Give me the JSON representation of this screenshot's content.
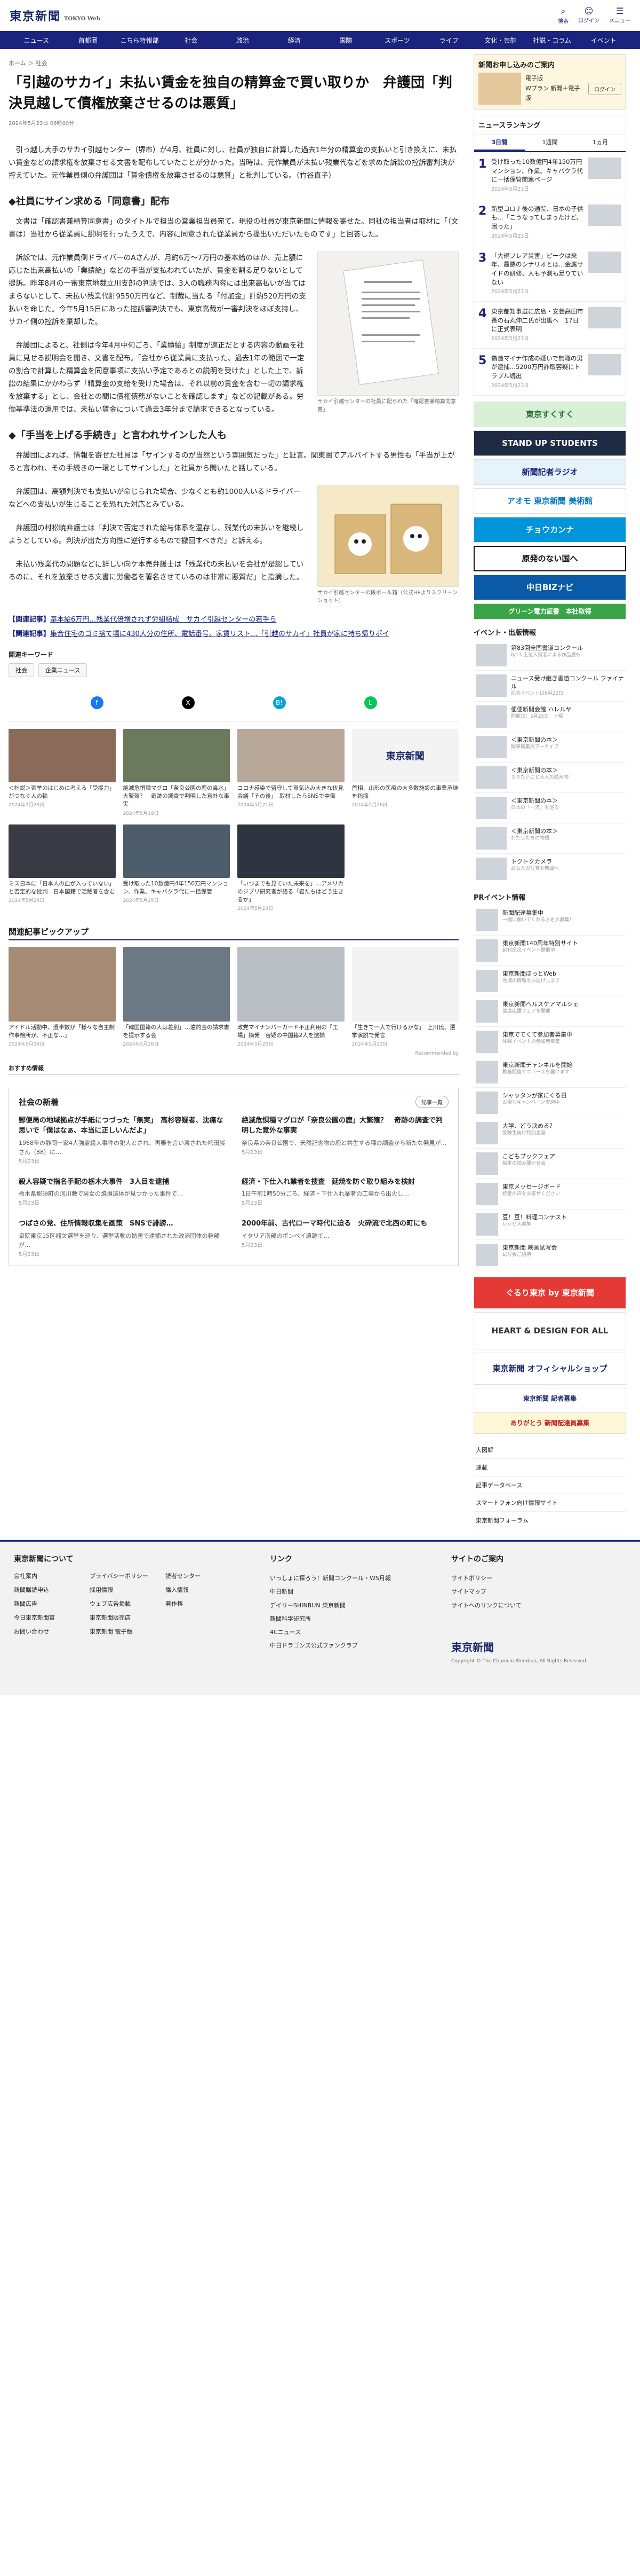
{
  "header": {
    "logo": "東京新聞",
    "logo_sub": "TOKYO Web",
    "icons": [
      {
        "name": "検索"
      },
      {
        "name": "ログイン"
      },
      {
        "name": "メニュー"
      }
    ]
  },
  "nav": [
    "ニュース",
    "首都圏",
    "こちら特報部",
    "社会",
    "政治",
    "経済",
    "国際",
    "スポーツ",
    "ライフ",
    "文化・芸能",
    "社説・コラム",
    "イベント"
  ],
  "breadcrumb": "ホーム ＞ 社会",
  "article": {
    "title": "「引越のサカイ」未払い賃金を独自の精算金で買い取りか　弁護団「判決見越して債権放棄させるのは悪質」",
    "date": "2024年5月23日 06時00分",
    "p1": "引っ越し大手のサカイ引越センター（堺市）が4月、社員に対し、社員が独自に計算した過去1年分の精算金の支払いと引き換えに、未払い賃金などの請求権を放棄させる文書を配布していたことが分かった。当時は、元作業員が未払い残業代などを求めた訴訟の控訴審判決が控えていた。元作業員側の弁護団は「賃金債権を放棄させるのは悪質」と批判している。（竹谷直子）",
    "h_a": "◆社員にサイン求める「同意書」配布",
    "p2": "文書は「確認書兼精算同意書」のタイトルで担当の営業担当員宛て。現役の社員が東京新聞に情報を寄せた。同社の担当者は取材に「（文書は）当社から従業員に説明を行ったうえで、内容に同意された従業員から提出いただいたものです」と回答した。",
    "p3": "訴訟では、元作業員側ドライバーのAさんが、月約6万～7万円の基本給のほか、売上額に応じた出来高払いの「業績給」などの手当が支払われていたが、賃金を割る足りないとして提訴。昨年8月の一審東京地裁立川支部の判決では、3人の職務内容には出来高払いが当てはまらないとして、未払い残業代計9550万円など、制裁に当たる「付加金」計約520万円の支払いを命じた。今年5月15日にあった控訴審判決でも、東京高裁が一審判決をほぼ支持し、サカイ側の控訴を棄却した。",
    "p4": "弁護団によると、社側は今年4月中旬ごろ、「業績給」制度が適正だとする内容の動画を社員に見せる説明会を開き、文書を配布。「会社から従業員に支払った、過去1年の範囲で一定の割合で計算した精算金を同意事項に支払い予定であるとの説明を受けた」とした上で、訴訟の結果にかかわらず「精算金の支給を受けた場合は、それ以前の賃金を含む一切の請求権を放棄する」とし、会社との間に債権債務がないことを確認します」などの記載がある。労働基準法の運用では、未払い賃金について過去3年分まで請求できるとなっている。",
    "fig1_cap": "サカイ引越センターの社員に配られた「確認書兼精算同意書」",
    "h_b": "◆「手当を上げる手続き」と言われサインした人も",
    "p5": "弁護団によれば、情報を寄せた社員は「サインするのが当然という雰囲気だった」と証言。関東圏でアルバイトする男性も「手当が上がると言われ、その手続きの一環としてサインした」と社員から聞いたと話している。",
    "p6": "弁護団は、高額判決でも支払いが命じられた場合、少なくとも約1000人いるドライバーなどへの支払いが生じることを恐れた対応とみている。",
    "p7": "弁護団の村松暁弁護士は「判決で否定された給与体系を温存し、残業代の未払いを継続しようとしている。判決が出た方向性に逆行するもので撤回すべきだ」と訴える。",
    "p8": "未払い残業代の問題などに詳しい向ケ本売弁護士は「残業代の未払いを会社が是認しているのに、それを放棄させる文書に労働者を署名させているのは非常に悪質だ」と指摘した。",
    "fig2_cap": "サカイ引越センターの段ボール箱（公式HPよりスクリーンショット）",
    "related": [
      {
        "label": "【関連記事】",
        "text": "基本給6万円…残業代倍増されず労組結成　サカイ引越センターの若手ら"
      },
      {
        "label": "【関連記事】",
        "text": "集合住宅のゴミ捨て場に430人分の住所、電話番号。家賃リスト…「引越のサカイ」社員が家に持ち帰りポイ"
      }
    ]
  },
  "keywords": {
    "title": "関連キーワード",
    "tags": [
      "社会",
      "企業ニュース"
    ]
  },
  "share": [
    "facebook-icon",
    "x-icon",
    "hatena-icon",
    "line-icon"
  ],
  "related_cards": [
    {
      "t": "＜社説＞選挙のはじめに考える「受援力」がつなぐ人の輪",
      "d": "2024年5月29日"
    },
    {
      "t": "絶滅危惧種マグロ「奈良公園の鹿の鼻水」大繁殖？　奇跡の調査で判明した意外な事実",
      "d": "2024年5月19日"
    },
    {
      "t": "コロナ感染で留守して意気込み大きな伏見会議「その後」　取材したらSNSで中傷",
      "d": "2024年5月21日"
    },
    {
      "t": "首相、山形の医療の大多数施設の事業承継を指摘",
      "d": "2024年5月26日"
    },
    {
      "t": "ミス日本に「日本人の血が入っていない」と否定的な批判　日本国籍で活躍者を含む",
      "d": "2024年5月24日"
    },
    {
      "t": "受け取った10数億円4年150万円マンション、作業、キャバクラ代に一括保管",
      "d": "2024年5月25日"
    },
    {
      "t": "「いつまでも見ていた未来を」…アメリカのジブリ研究者が語る「君たちはどう生きるか」",
      "d": "2024年5月23日"
    },
    {
      "t": "東京新聞",
      "d": ""
    }
  ],
  "pickup": {
    "title": "関連記事ピックアップ",
    "items": [
      {
        "t": "アイドル活動中、過半数が「様々な自主制作事務所が、不正な…」",
        "s": "2024年5月24日"
      },
      {
        "t": "「韓国国籍の人は差別」…違約金の請求書を提示する会",
        "s": "2024年5月26日"
      },
      {
        "t": "政党マイナンバーカード不正利用の「工場」摘発　容疑の中国籍2人を逮捕",
        "s": "2024年5月20日"
      },
      {
        "t": "「生きて一人で行けるかな」　上川氏、選挙演説で発言",
        "s": "2024年5月22日"
      }
    ],
    "credit": "Recommended by",
    "cta": "おすすめ情報"
  },
  "latest": {
    "title": "社会の新着",
    "more": "記事一覧",
    "items": [
      {
        "h": "郵便局の地域拠点が手紙につづった「無実」　高杉容疑者、沈痛な思いで「僕はなぁ、本当に正しいんだよ」",
        "p": "1968年の静岡一家4人強盗殺人事件の犯人とされ、再審を言い渡された袴田巌さん（88）に…",
        "d": "5月23日"
      },
      {
        "h": "絶滅危惧種マグロが「奈良公園の鹿」大繁殖？　奇跡の調査で判明した意外な事実",
        "p": "奈良県の奈良公園で、天然記念物の鹿と共生する種の調査から新たな発見が…",
        "d": "5月23日"
      },
      {
        "h": "殺人容疑で指名手配の栃木大事件　3人目を逮捕",
        "p": "栃木県那須町の河川敷で男女の焼損遺体が見つかった事件で…",
        "d": "5月23日"
      },
      {
        "h": "経済・下仕入れ業者を捜査　延焼を防ぐ取り組みを検討",
        "p": "1日午前1時50分ごろ、経済・下仕入れ業者の工場から出火し…",
        "d": "5月23日"
      },
      {
        "h": "つばさの党、住所情報収集を画策　SNSで誹謗…",
        "p": "衆院東京15区補欠選挙を巡り、選挙活動の妨害で逮捕された政治団体の幹部が…",
        "d": "5月23日"
      },
      {
        "h": "2000年前、古代ローマ時代に迫る　火砕流で北西の町にも",
        "p": "イタリア南部のポンペイ遺跡で…",
        "d": "5月23日"
      }
    ]
  },
  "side": {
    "promo_title": "新聞お申し込みのご案内",
    "promo_lines": [
      "電子版",
      "Wプラン 新聞＋電子版"
    ],
    "promo_btn": "ログイン",
    "ranking": {
      "title": "ニュースランキング",
      "tabs": [
        "3日間",
        "1週間",
        "1ヵ月"
      ],
      "items": [
        {
          "n": "1",
          "t": "受け取った10数億円4年150万円マンション、作業、キャバクラ代に一括保管関連ページ",
          "s": "2024年5月23日"
        },
        {
          "n": "2",
          "t": "新型コロナ後の通院、日本の子供も…「こうなってしまったけど、困った」",
          "s": "2024年5月23日"
        },
        {
          "n": "3",
          "t": "「大規フレア災害」ピークは来年、最悪のシナリオとは…金属サイドの研修、人も予測も足りていない",
          "s": "2024年5月23日"
        },
        {
          "n": "4",
          "t": "東京都知事選に広島・安芸高田市長の石丸伸二氏が出馬へ　17日に正式表明",
          "s": "2024年5月23日"
        },
        {
          "n": "5",
          "t": "偽造マイナ作成の疑いで無職の男が逮捕…5200万円詐取容疑にトラブル続出",
          "s": "2024年5月23日"
        }
      ]
    },
    "banners": [
      "東京すくすく",
      "STAND UP STUDENTS",
      "新聞記者ラジオ",
      "アオモ 東京新聞 美術館",
      "チョウカンナ",
      "原発のない国へ",
      "中日BIZナビ",
      "グリーン電力証書　本社取得"
    ],
    "events_title": "イベント・出版情報",
    "events": [
      {
        "t": "第83回全国書道コンクール",
        "s": "6/13 上位入賞者による作品展も"
      },
      {
        "t": "ニュース受け継ぎ書道コンクール ファイナル",
        "s": "記念イベントは6月22日"
      },
      {
        "t": "便便新聞会館 ハレルヤ",
        "s": "開催日：5月25日　土曜"
      },
      {
        "t": "＜東京新聞の本＞",
        "s": "関東編集局アーカイブ"
      },
      {
        "t": "＜東京新聞の本＞",
        "s": "ききたいこと大人の読み物"
      },
      {
        "t": "＜東京新聞の本＞",
        "s": "日本の「一流」を巡る"
      },
      {
        "t": "＜東京新聞の本＞",
        "s": "わたしたちの物語"
      },
      {
        "t": "トクトクカメラ",
        "s": "あなたの写真を新聞へ"
      }
    ],
    "pr_title": "PRイベント情報",
    "pr": [
      {
        "t": "新聞配達募集中",
        "s": "一緒に働いてくれる方を大募集！"
      },
      {
        "t": "東京新聞140周年特別サイト",
        "s": "創刊記念イベント開催中"
      },
      {
        "t": "東京新聞ほっとWeb",
        "s": "地域の情報をお届けします"
      },
      {
        "t": "東京新聞へルスケアマルシェ",
        "s": "健康応援フェアを開催"
      },
      {
        "t": "東京でてくて参加者募集中",
        "s": "体験イベントの参加者募集"
      },
      {
        "t": "東京新聞チャンネルを開始",
        "s": "動画配信でニュースを届けます"
      },
      {
        "t": "シャッタンが家にくる日",
        "s": "お得なキャンペーン実施中"
      },
      {
        "t": "大学、どう決める？",
        "s": "受験生向け特別企画"
      },
      {
        "t": "こどもブックフェア",
        "s": "絵本の読み聞かせ会"
      },
      {
        "t": "東京メッセージボード",
        "s": "読者の声をお寄せください"
      },
      {
        "t": "豆！豆！料理コンテスト",
        "s": "レシピ大募集"
      },
      {
        "t": "東京新聞 映画試写会",
        "s": "試写会ご招待"
      }
    ],
    "banners2": [
      "ぐるり東京 by 東京新聞",
      "HEART & DESIGN FOR ALL",
      "東京新聞 オフィシャルショップ",
      "東京新聞 記者募集",
      "ありがとう 新聞配達員募集"
    ],
    "links": [
      "大図解",
      "連載",
      "記事データベース",
      "スマートフォン向け情報サイト",
      "東京新聞フォーラム"
    ]
  },
  "footer": {
    "col1_title": "東京新聞について",
    "col1": [
      "会社案内",
      "新聞購読申込",
      "新聞広告",
      "今日東京新聞賞",
      "お問い合わせ",
      "プライバシーポリシー",
      "採用情報",
      "ウェブ広告掲載",
      "東京新聞販売店",
      "東京新聞 電子版",
      "読者センター",
      "購入情報",
      "著作権"
    ],
    "col2_title": "リンク",
    "col2": [
      "いっしょに探ろう！新聞コンクール・WS月報",
      "中日新聞",
      "デイリーSHINBUN 東京新聞",
      "新聞科学研究所",
      "4Cニュース",
      "中日ドラゴンズ公式ファンクラブ"
    ],
    "col3_title": "サイトのご案内",
    "col3": [
      "サイトポリシー",
      "サイトマップ",
      "サイトへのリンクについて"
    ],
    "logo": "東京新聞",
    "copy": "Copyright © The Chunichi Shimbun, All Rights Reserved."
  }
}
